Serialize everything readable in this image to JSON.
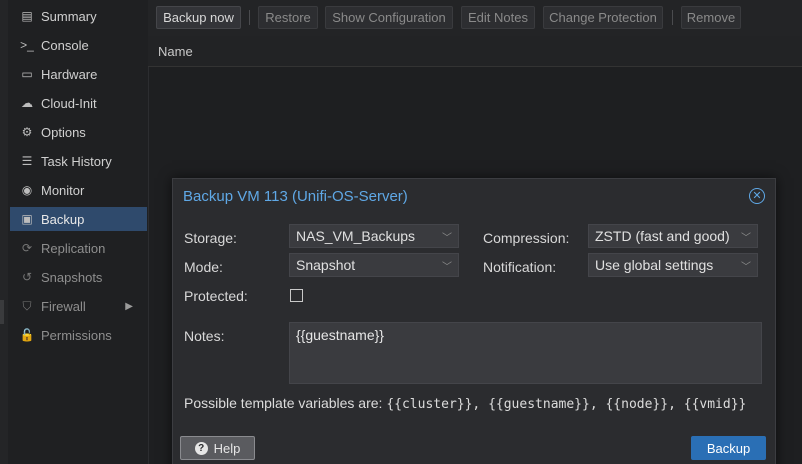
{
  "sidebar": {
    "items": [
      {
        "icon": "summary-icon",
        "glyph": "▤",
        "label": "Summary"
      },
      {
        "icon": "console-icon",
        "glyph": ">_",
        "label": "Console"
      },
      {
        "icon": "hardware-icon",
        "glyph": "▭",
        "label": "Hardware"
      },
      {
        "icon": "cloud-icon",
        "glyph": "☁",
        "label": "Cloud-Init"
      },
      {
        "icon": "gear-icon",
        "glyph": "⚙",
        "label": "Options"
      },
      {
        "icon": "task-history-icon",
        "glyph": "☰",
        "label": "Task History"
      },
      {
        "icon": "eye-icon",
        "glyph": "◉",
        "label": "Monitor"
      },
      {
        "icon": "floppy-icon",
        "glyph": "▣",
        "label": "Backup"
      },
      {
        "icon": "replication-icon",
        "glyph": "⟳",
        "label": "Replication"
      },
      {
        "icon": "history-icon",
        "glyph": "↺",
        "label": "Snapshots"
      },
      {
        "icon": "shield-icon",
        "glyph": "⛉",
        "label": "Firewall"
      },
      {
        "icon": "unlock-icon",
        "glyph": "🔓",
        "label": "Permissions"
      }
    ]
  },
  "toolbar": {
    "backup_now": "Backup now",
    "restore": "Restore",
    "show_configuration": "Show Configuration",
    "edit_notes": "Edit Notes",
    "change_protection": "Change Protection",
    "remove": "Remove"
  },
  "grid": {
    "name_header": "Name"
  },
  "dialog": {
    "title": "Backup VM 113 (Unifi-OS-Server)",
    "storage_label": "Storage:",
    "storage_value": "NAS_VM_Backups",
    "mode_label": "Mode:",
    "mode_value": "Snapshot",
    "protected_label": "Protected:",
    "compression_label": "Compression:",
    "compression_value": "ZSTD (fast and good)",
    "notification_label": "Notification:",
    "notification_value": "Use global settings",
    "notes_label": "Notes:",
    "notes_value": "{{guestname}}",
    "hint_prefix": "Possible template variables are: ",
    "hint_vars": "{{cluster}}, {{guestname}}, {{node}}, {{vmid}}",
    "help_label": "Help",
    "backup_label": "Backup"
  },
  "colors": {
    "accent": "#5fa8e6",
    "active_nav": "#2f4a6c",
    "primary_button": "#2a6fb5"
  }
}
